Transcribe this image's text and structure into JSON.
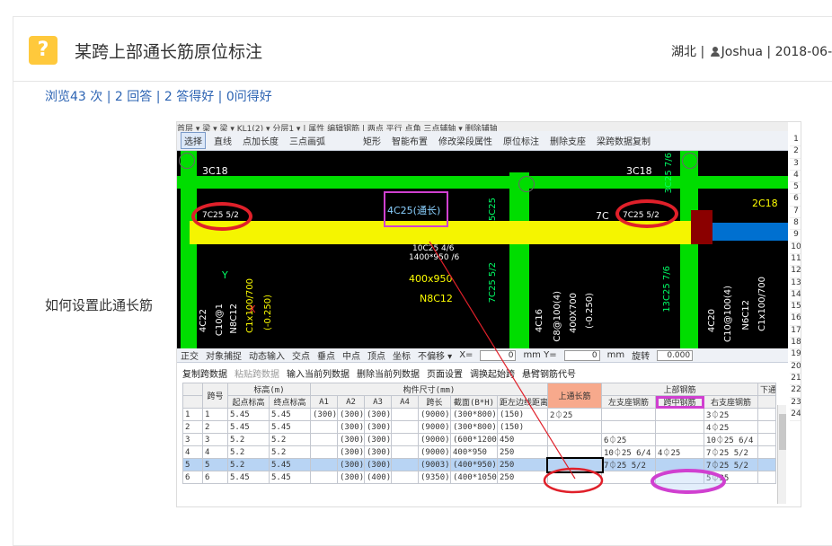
{
  "header": {
    "icon": "question-mark-icon",
    "icon_glyph": "?",
    "title": "某跨上部通长筋原位标注",
    "location": "湖北",
    "sep1": " | ",
    "author": "Joshua",
    "sep2": " | ",
    "date": "2018-06-"
  },
  "stats": "浏览43 次 | 2 回答 | 2 答得好 | 0问得好",
  "question_text": "如何设置此通长筋",
  "screenshot": {
    "toolbar_top": "首层 ▾  梁 ▾  梁 ▾  KL1(2) ▾  分层1 ▾  | 属性  编辑钢筋   | 两点  平行  点角  三点辅轴 ▾  删除辅轴",
    "toolbar": [
      "选择",
      "直线",
      "点加长度",
      "三点画弧",
      "矩形",
      "智能布置",
      "修改梁段属性",
      "原位标注",
      "删除支座",
      "梁跨数据复制"
    ],
    "cad_labels": {
      "tl": "3C18",
      "tr": "3C18",
      "r2c18": "2C18",
      "left_note": "7C25 5/2",
      "center_box": "4C25(通长)",
      "right_note": "7C25 5/2",
      "right_note_b": "7C",
      "mid1": "10C25 4/6",
      "mid2": "1400*950 /6",
      "mid3": "400x950",
      "mid4": "N8C12",
      "v5c25": "5C25",
      "v7c25": "7C25 5/2",
      "v13c25": "13C25 7/6",
      "v3c25": "3C25 7/6",
      "v4c16": "4C16",
      "vc8": "C8@100(4)",
      "v400": "400X700",
      "v025": "(-0.250)",
      "v4c20": "4C20",
      "vc10": "C10@100(4)",
      "vn6": "N6C12",
      "vc1": "C1x100/700",
      "vleft1": "4C22",
      "vleft2": "C10@1",
      "vleft3": "N8C12",
      "vleft4": "C1x100/700",
      "vleft5": "(-0.250)",
      "axis_y": "Y",
      "axis_x": "X"
    },
    "snapbar": [
      "正交",
      "对象捕捉",
      "动态输入",
      "交点",
      "垂点",
      "中点",
      "顶点",
      "坐标",
      "不偏移 ▾",
      "X=",
      "mm Y=",
      "mm",
      "旋转"
    ],
    "snap_x": "0",
    "snap_y": "0",
    "snap_rot": "0.000",
    "panel_toolbar": [
      "复制跨数据",
      "粘贴跨数据",
      "输入当前列数据",
      "删除当前列数据",
      "页面设置",
      "调换起始跨",
      "悬臂钢筋代号"
    ],
    "table": {
      "group_headers": [
        "",
        "跨号",
        "标高(m)",
        "构件尺寸(mm)",
        "上通长筋",
        "上部钢筋",
        "下通"
      ],
      "sub_headers": [
        "",
        "",
        "起点标高",
        "终点标高",
        "A1",
        "A2",
        "A3",
        "A4",
        "跨长",
        "截面(B*H)",
        "距左边线距离",
        "",
        "左支座钢筋",
        "跨中钢筋",
        "右支座钢筋",
        ""
      ],
      "rows": [
        [
          "1",
          "1",
          "5.45",
          "5.45",
          "(300)",
          "(300)",
          "(300)",
          "",
          "(9000)",
          "(300*800)",
          "(150)",
          "2⏀25",
          "",
          "",
          "3⏀25",
          ""
        ],
        [
          "2",
          "2",
          "5.45",
          "5.45",
          "",
          "(300)",
          "(300)",
          "",
          "(9000)",
          "(300*800)",
          "(150)",
          "",
          "",
          "",
          "4⏀25",
          ""
        ],
        [
          "3",
          "3",
          "5.2",
          "5.2",
          "",
          "(300)",
          "(300)",
          "",
          "(9000)",
          "(600*1200)",
          "450",
          "",
          "6⏀25",
          "",
          "10⏀25 6/4",
          ""
        ],
        [
          "4",
          "4",
          "5.2",
          "5.2",
          "",
          "(300)",
          "(300)",
          "",
          "(9000)",
          "400*950",
          "250",
          "",
          "10⏀25 6/4",
          "4⏀25",
          "7⏀25 5/2",
          ""
        ],
        [
          "5",
          "5",
          "5.2",
          "5.45",
          "",
          "(300)",
          "(300)",
          "",
          "(9003)",
          "(400*950)",
          "250",
          "",
          "7⏀25 5/2",
          "",
          "7⏀25 5/2",
          ""
        ],
        [
          "6",
          "6",
          "5.45",
          "5.45",
          "",
          "(300)",
          "(400)",
          "",
          "(9350)",
          "(400*1050)",
          "250",
          "",
          "",
          "",
          "5⏀25",
          ""
        ]
      ]
    },
    "row_numbers": [
      "1",
      "2",
      "3",
      "4",
      "5",
      "6",
      "7",
      "8",
      "9",
      "10",
      "11",
      "12",
      "13",
      "14",
      "15",
      "16",
      "17",
      "18",
      "19",
      "20",
      "21",
      "22",
      "23",
      "24"
    ]
  },
  "colors": {
    "cad_bg": "#000000",
    "beam_yellow": "#f5f500",
    "column_green": "#00dd00",
    "annot_red": "#e0202a",
    "annot_magenta": "#d040d0",
    "link_blue": "#2d64b3"
  }
}
